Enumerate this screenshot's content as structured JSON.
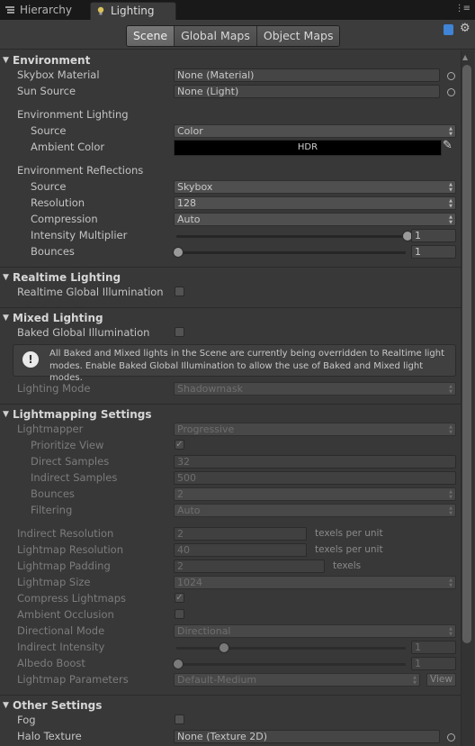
{
  "tabs": [
    {
      "label": "Hierarchy",
      "icon": "hierarchy-icon",
      "active": false
    },
    {
      "label": "Lighting",
      "icon": "lighting-icon",
      "active": true
    }
  ],
  "toolbar": {
    "segments": [
      "Scene",
      "Global Maps",
      "Object Maps"
    ],
    "active": "Scene"
  },
  "environment": {
    "title": "Environment",
    "skybox_material": {
      "label": "Skybox Material",
      "value": "None (Material)"
    },
    "sun_source": {
      "label": "Sun Source",
      "value": "None (Light)"
    },
    "lighting_heading": "Environment Lighting",
    "lighting_source": {
      "label": "Source",
      "value": "Color"
    },
    "ambient_color": {
      "label": "Ambient Color",
      "value": "HDR",
      "color": "#000000"
    },
    "reflections_heading": "Environment Reflections",
    "reflections_source": {
      "label": "Source",
      "value": "Skybox"
    },
    "resolution": {
      "label": "Resolution",
      "value": "128"
    },
    "compression": {
      "label": "Compression",
      "value": "Auto"
    },
    "intensity_multiplier": {
      "label": "Intensity Multiplier",
      "value": "1",
      "fraction": 1.0
    },
    "bounces": {
      "label": "Bounces",
      "value": "1",
      "fraction": 0.0
    }
  },
  "realtime": {
    "title": "Realtime Lighting",
    "gi": {
      "label": "Realtime Global Illumination",
      "checked": false
    }
  },
  "mixed": {
    "title": "Mixed Lighting",
    "baked_gi": {
      "label": "Baked Global Illumination",
      "checked": false
    },
    "help_line1": "All Baked and Mixed lights in the Scene are currently being overridden to Realtime light",
    "help_line2": "modes. Enable Baked Global Illumination to allow the use of Baked and Mixed light modes.",
    "lighting_mode": {
      "label": "Lighting Mode",
      "value": "Shadowmask"
    }
  },
  "lightmapping": {
    "title": "Lightmapping Settings",
    "lightmapper": {
      "label": "Lightmapper",
      "value": "Progressive"
    },
    "prioritize_view": {
      "label": "Prioritize View",
      "checked": true
    },
    "direct_samples": {
      "label": "Direct Samples",
      "value": "32"
    },
    "indirect_samples": {
      "label": "Indirect Samples",
      "value": "500"
    },
    "bounces": {
      "label": "Bounces",
      "value": "2"
    },
    "filtering": {
      "label": "Filtering",
      "value": "Auto"
    },
    "indirect_resolution": {
      "label": "Indirect Resolution",
      "value": "2",
      "suffix": "texels per unit"
    },
    "lightmap_resolution": {
      "label": "Lightmap Resolution",
      "value": "40",
      "suffix": "texels per unit"
    },
    "lightmap_padding": {
      "label": "Lightmap Padding",
      "value": "2",
      "suffix": "texels"
    },
    "lightmap_size": {
      "label": "Lightmap Size",
      "value": "1024"
    },
    "compress_lightmaps": {
      "label": "Compress Lightmaps",
      "checked": true
    },
    "ambient_occlusion": {
      "label": "Ambient Occlusion",
      "checked": false
    },
    "directional_mode": {
      "label": "Directional Mode",
      "value": "Directional"
    },
    "indirect_intensity": {
      "label": "Indirect Intensity",
      "value": "1",
      "fraction": 0.2
    },
    "albedo_boost": {
      "label": "Albedo Boost",
      "value": "1",
      "fraction": 0.0
    },
    "lightmap_parameters": {
      "label": "Lightmap Parameters",
      "value": "Default-Medium",
      "view_label": "View"
    }
  },
  "other": {
    "title": "Other Settings",
    "fog": {
      "label": "Fog",
      "checked": false
    },
    "halo_texture": {
      "label": "Halo Texture",
      "value": "None (Texture 2D)"
    }
  }
}
